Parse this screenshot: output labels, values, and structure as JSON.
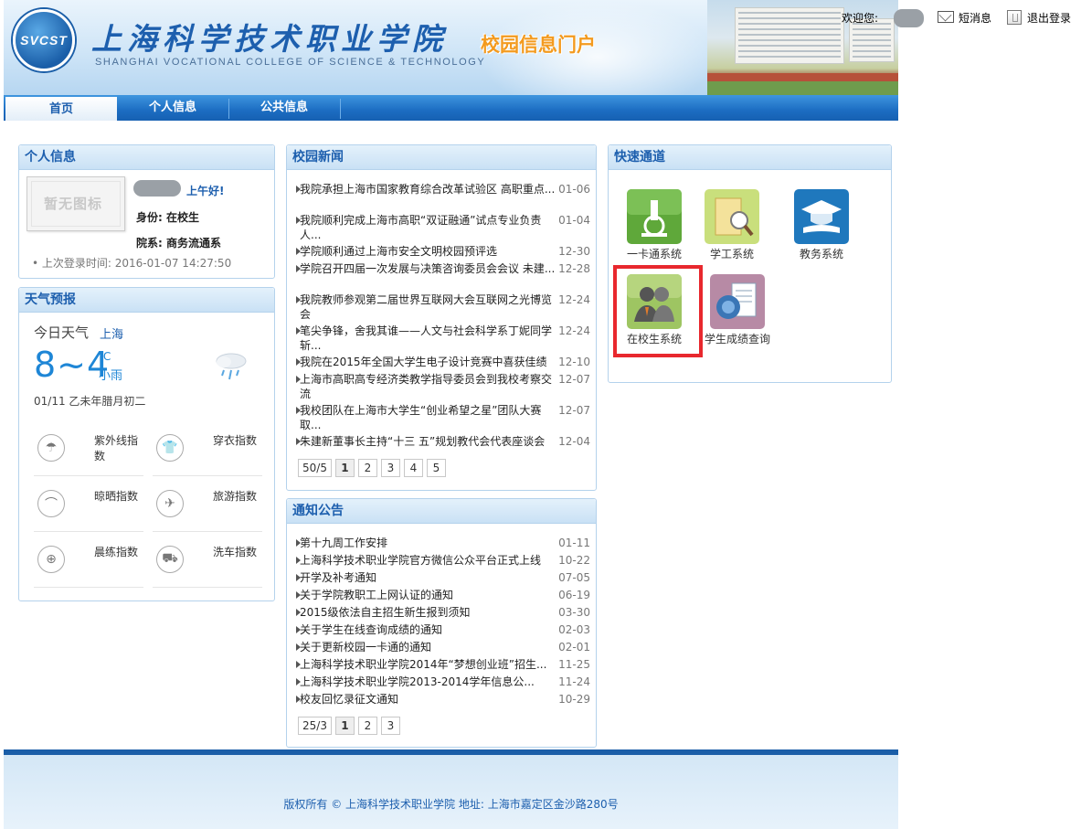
{
  "header": {
    "logo_text": "SVCST",
    "college_cn": "上海科学技术职业学院",
    "college_en": "SHANGHAI VOCATIONAL COLLEGE OF SCIENCE & TECHNOLOGY",
    "portal_title": "校园信息门户",
    "welcome": "欢迎您:",
    "messages": "短消息",
    "logout": "退出登录"
  },
  "nav": {
    "tabs": [
      "首页",
      "个人信息",
      "公共信息"
    ]
  },
  "personal": {
    "title": "个人信息",
    "avatar_text": "暂无图标",
    "greeting": "上午好!",
    "identity": "身份: 在校生",
    "department": "院系: 商务流通系",
    "last_login": "• 上次登录时间: 2016-01-07 14:27:50"
  },
  "weather": {
    "title": "天气预报",
    "today": "今日天气",
    "city": "上海",
    "temp": "8~4",
    "unit": "℃",
    "desc": "小雨",
    "date": "01/11 乙未年腊月初二",
    "indices": [
      "紫外线指数",
      "穿衣指数",
      "晾晒指数",
      "旅游指数",
      "晨练指数",
      "洗车指数"
    ]
  },
  "news": {
    "title": "校园新闻",
    "items": [
      {
        "title": "我院承担上海市国家教育综合改革试验区 高职重点...",
        "date": "01-06"
      },
      {
        "title": "我院顺利完成上海市高职“双证融通”试点专业负责人...",
        "date": "01-04"
      },
      {
        "title": "学院顺利通过上海市安全文明校园预评选",
        "date": "12-30"
      },
      {
        "title": "学院召开四届一次发展与决策咨询委员会会议 未建...",
        "date": "12-28"
      },
      {
        "title": "我院教师参观第二届世界互联网大会互联网之光博览会",
        "date": "12-24"
      },
      {
        "title": "笔尖争锋，舍我其谁——人文与社会科学系丁妮同学斩...",
        "date": "12-24"
      },
      {
        "title": "我院在2015年全国大学生电子设计竞赛中喜获佳绩",
        "date": "12-10"
      },
      {
        "title": "上海市高职高专经济类教学指导委员会到我校考察交流",
        "date": "12-07"
      },
      {
        "title": "我校团队在上海市大学生“创业希望之星”团队大赛取...",
        "date": "12-07"
      },
      {
        "title": "朱建新董事长主持“十三 五”规划教代会代表座谈会",
        "date": "12-04"
      }
    ],
    "pager": [
      "50/5",
      "1",
      "2",
      "3",
      "4",
      "5"
    ]
  },
  "notices": {
    "title": "通知公告",
    "items": [
      {
        "title": "第十九周工作安排",
        "date": "01-11"
      },
      {
        "title": "上海科学技术职业学院官方微信公众平台正式上线",
        "date": "10-22"
      },
      {
        "title": "开学及补考通知",
        "date": "07-05"
      },
      {
        "title": "关于学院教职工上网认证的通知",
        "date": "06-19"
      },
      {
        "title": "2015级依法自主招生新生报到须知",
        "date": "03-30"
      },
      {
        "title": "关于学生在线查询成绩的通知",
        "date": "02-03"
      },
      {
        "title": "关于更新校园一卡通的通知",
        "date": "02-01"
      },
      {
        "title": "上海科学技术职业学院2014年“梦想创业班”招生...",
        "date": "11-25"
      },
      {
        "title": "上海科学技术职业学院2013-2014学年信息公...",
        "date": "11-24"
      },
      {
        "title": "校友回忆录征文通知",
        "date": "10-29"
      }
    ],
    "pager": [
      "25/3",
      "1",
      "2",
      "3"
    ]
  },
  "quick": {
    "title": "快速通道",
    "items": [
      {
        "label": "一卡通系统",
        "icon": "microscope-icon",
        "color": "#5fa83a"
      },
      {
        "label": "学工系统",
        "icon": "folder-search-icon",
        "color": "#c9df7c"
      },
      {
        "label": "教务系统",
        "icon": "graduation-cap-icon",
        "color": "#1f78bd"
      },
      {
        "label": "在校生系统",
        "icon": "students-icon",
        "color": "#9ec562"
      },
      {
        "label": "学生成绩查询",
        "icon": "report-icon",
        "color": "#b78aa5"
      }
    ]
  },
  "footer": {
    "text": "版权所有 © 上海科学技术职业学院 地址: 上海市嘉定区金沙路280号"
  }
}
